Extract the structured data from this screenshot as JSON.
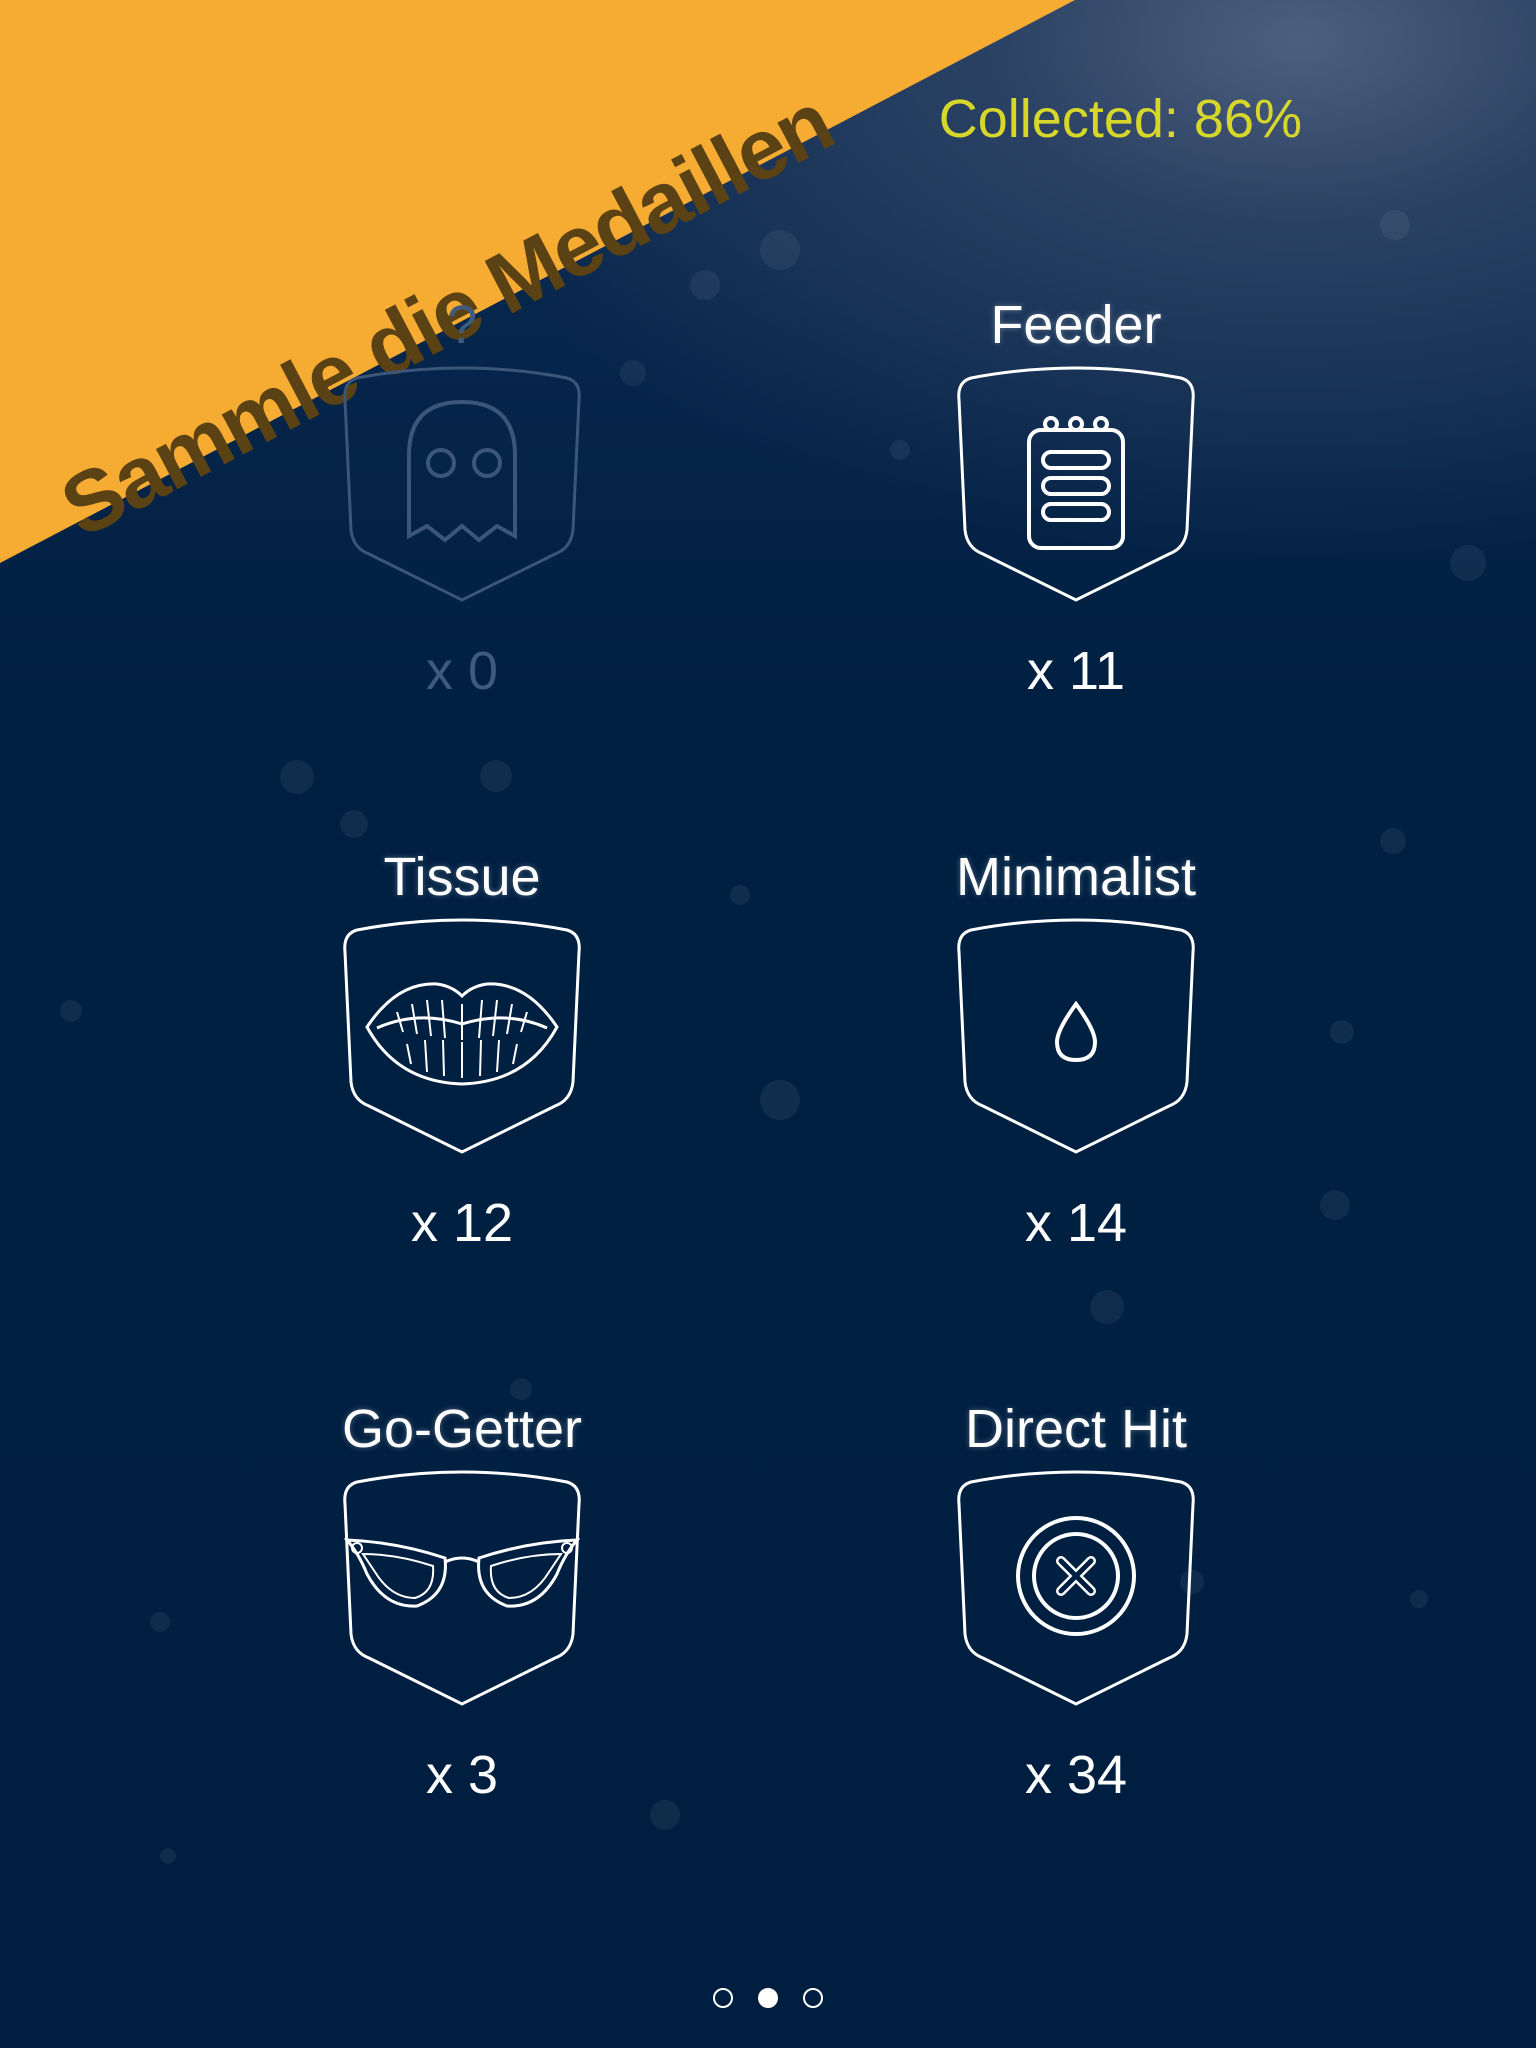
{
  "banner": {
    "text": "Sammle die Medaillen",
    "color": "#f6ab32"
  },
  "collected_label": "Collected: 86%",
  "medals": [
    {
      "name": "?",
      "count": "x 0",
      "icon": "ghost-icon",
      "locked": true
    },
    {
      "name": "Feeder",
      "count": "x 11",
      "icon": "notepad-icon",
      "locked": false
    },
    {
      "name": "Tissue",
      "count": "x 12",
      "icon": "lips-icon",
      "locked": false
    },
    {
      "name": "Minimalist",
      "count": "x 14",
      "icon": "drop-icon",
      "locked": false
    },
    {
      "name": "Go-Getter",
      "count": "x 3",
      "icon": "glasses-icon",
      "locked": false
    },
    {
      "name": "Direct Hit",
      "count": "x 34",
      "icon": "target-x-icon",
      "locked": false
    }
  ],
  "pagination": {
    "pages": 3,
    "current": 2
  }
}
